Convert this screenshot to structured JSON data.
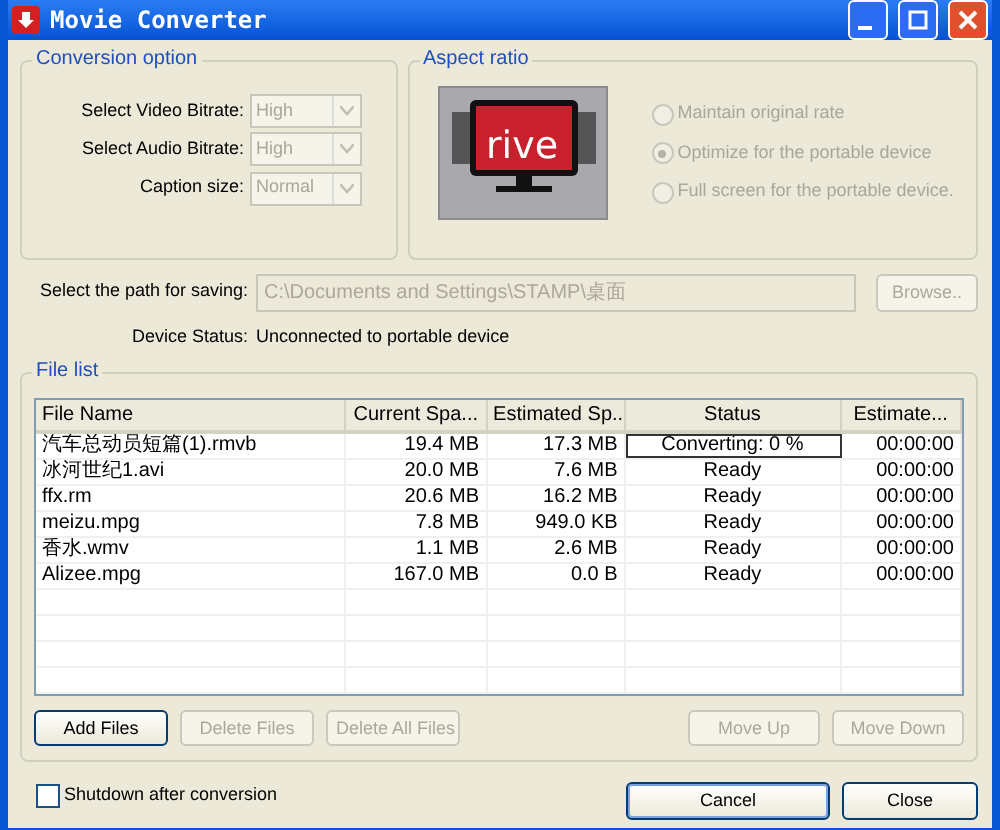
{
  "window": {
    "title": "Movie Converter"
  },
  "conversion_option": {
    "title": "Conversion option",
    "fields": [
      {
        "label": "Select Video Bitrate:",
        "value": "High",
        "disabled": true
      },
      {
        "label": "Select Audio Bitrate:",
        "value": "High",
        "disabled": true
      },
      {
        "label": "Caption size:",
        "value": "Normal",
        "disabled": true
      }
    ]
  },
  "aspect_ratio": {
    "title": "Aspect ratio",
    "logo_text": "rive",
    "options": [
      {
        "label": "Maintain original rate",
        "selected": false,
        "disabled": true
      },
      {
        "label": "Optimize for the portable device",
        "selected": true,
        "disabled": true
      },
      {
        "label": "Full screen for the portable device.",
        "selected": false,
        "disabled": true
      }
    ]
  },
  "save_path": {
    "label": "Select the path for saving:",
    "value": "C:\\Documents and Settings\\STAMP\\桌面",
    "button": {
      "label": "Browse..",
      "disabled": true
    }
  },
  "device_status": {
    "label": "Device Status:",
    "value": "Unconnected to portable device"
  },
  "file_list": {
    "title": "File list",
    "columns": [
      "File Name",
      "Current Spa...",
      "Estimated Sp...",
      "Status",
      "Estimate..."
    ],
    "rows": [
      {
        "cells": [
          "汽车总动员短篇(1).rmvb",
          "19.4 MB",
          "17.3 MB",
          "Converting: 0 %",
          "00:00:00"
        ],
        "active": true
      },
      {
        "cells": [
          "冰河世纪1.avi",
          "20.0 MB",
          "7.6 MB",
          "Ready",
          "00:00:00"
        ],
        "active": false
      },
      {
        "cells": [
          "ffx.rm",
          "20.6 MB",
          "16.2 MB",
          "Ready",
          "00:00:00"
        ],
        "active": false
      },
      {
        "cells": [
          "meizu.mpg",
          "7.8 MB",
          "949.0 KB",
          "Ready",
          "00:00:00"
        ],
        "active": false
      },
      {
        "cells": [
          "香水.wmv",
          "1.1 MB",
          "2.6 MB",
          "Ready",
          "00:00:00"
        ],
        "active": false
      },
      {
        "cells": [
          "Alizee.mpg",
          "167.0 MB",
          "0.0 B",
          "Ready",
          "00:00:00"
        ],
        "active": false
      }
    ],
    "buttons": [
      {
        "label": "Add Files",
        "disabled": false
      },
      {
        "label": "Delete Files",
        "disabled": true
      },
      {
        "label": "Delete All Files",
        "disabled": true
      },
      {
        "label": "Move Up",
        "disabled": true
      },
      {
        "label": "Move Down",
        "disabled": true
      }
    ]
  },
  "shutdown": {
    "label": "Shutdown after conversion",
    "checked": false
  },
  "dialog_buttons": [
    {
      "label": "Cancel",
      "focused": true
    },
    {
      "label": "Close",
      "focused": false
    }
  ]
}
